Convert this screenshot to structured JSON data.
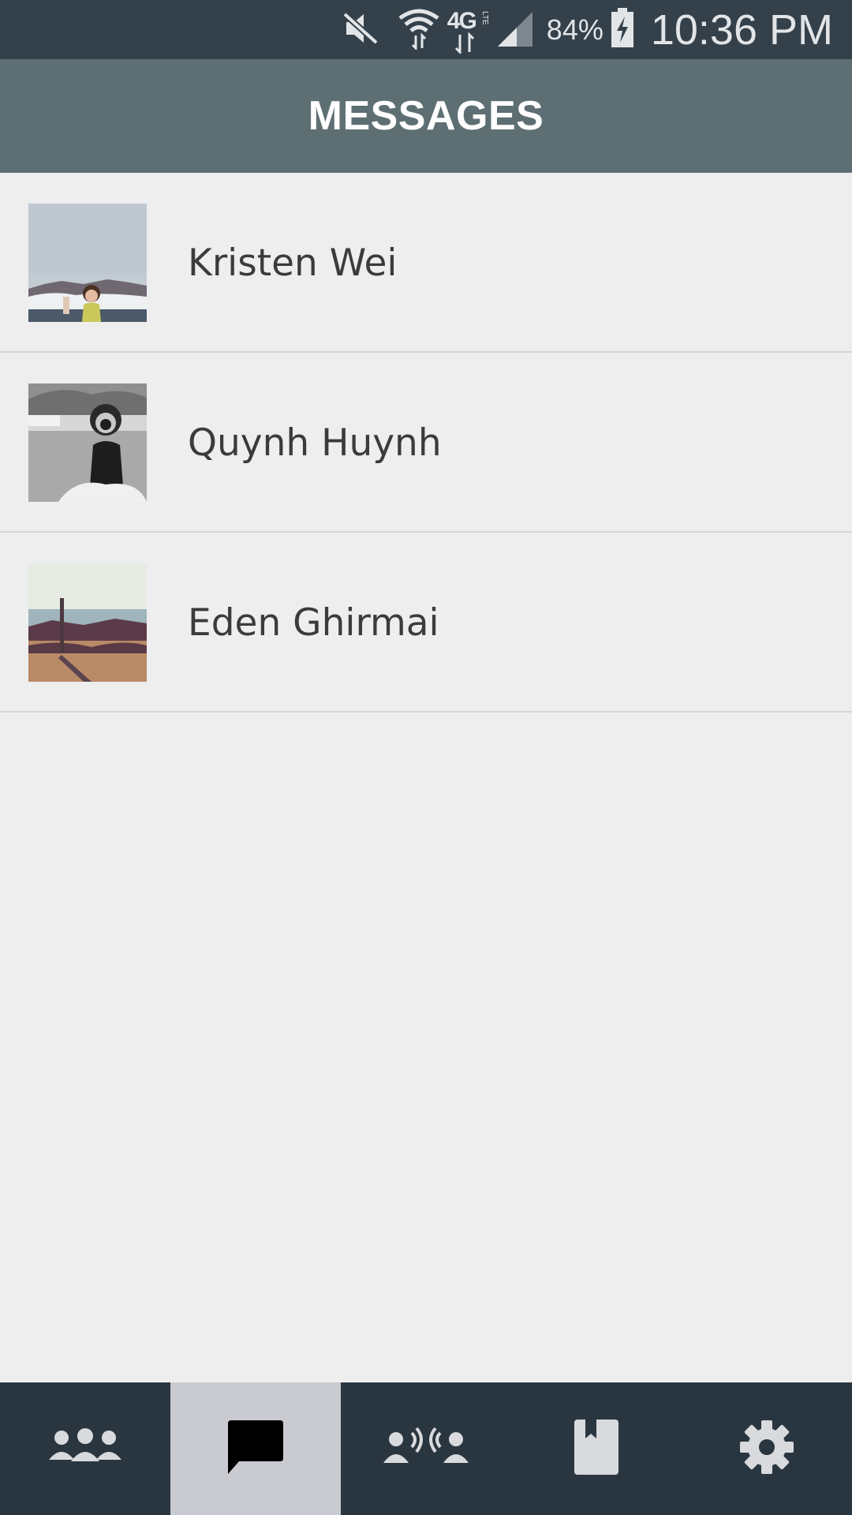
{
  "status_bar": {
    "battery_percent": "84%",
    "time": "10:36 PM",
    "network_type": "4G",
    "network_sub": "LTE",
    "icons": [
      "mute-icon",
      "wifi-icon",
      "4g-lte-icon",
      "signal-icon",
      "battery-charging-icon"
    ]
  },
  "header": {
    "title": "MESSAGES"
  },
  "conversations": [
    {
      "name": "Kristen Wei"
    },
    {
      "name": "Quynh Huynh"
    },
    {
      "name": "Eden Ghirmai"
    }
  ],
  "bottom_nav": {
    "active_index": 1,
    "items": [
      {
        "icon": "group-icon"
      },
      {
        "icon": "message-icon"
      },
      {
        "icon": "voice-call-icon"
      },
      {
        "icon": "book-icon"
      },
      {
        "icon": "settings-icon"
      }
    ]
  },
  "colors": {
    "status_bar": "#34414b",
    "header": "#5e6f73",
    "background": "#eeeeef",
    "nav_bar": "#293640",
    "nav_active": "#cacbd0",
    "nav_icon": "#d9dadd"
  }
}
